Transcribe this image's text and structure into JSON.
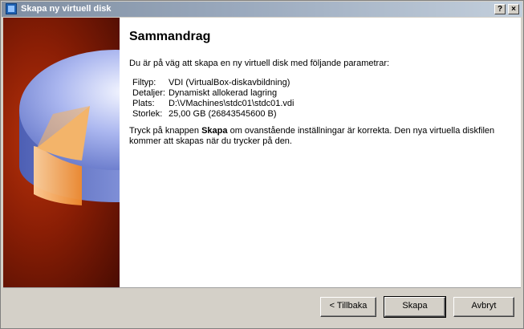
{
  "window": {
    "title": "Skapa ny virtuell disk",
    "help_glyph": "?",
    "close_glyph": "×",
    "icon": "virtualbox-icon"
  },
  "main": {
    "heading": "Sammandrag",
    "intro": "Du är på väg att skapa en ny virtuell disk med följande parametrar:",
    "params": [
      {
        "key": "Filtyp:",
        "value": "VDI (VirtualBox-diskavbildning)"
      },
      {
        "key": "Detaljer:",
        "value": "Dynamiskt allokerad lagring"
      },
      {
        "key": "Plats:",
        "value": "D:\\VMachines\\stdc01\\stdc01.vdi"
      },
      {
        "key": "Storlek:",
        "value": "25,00 GB (26843545600 B)"
      }
    ],
    "note_before": "Tryck på knappen ",
    "note_bold": "Skapa",
    "note_after": " om ovanstående inställningar är korrekta. Den nya virtuella diskfilen kommer att skapas när du trycker på den."
  },
  "buttons": {
    "back": "< Tillbaka",
    "create": "Skapa",
    "cancel": "Avbryt"
  },
  "colors": {
    "sidebar_bg": "#8a1e05",
    "disk_blue": "#7a8bd6",
    "disk_orange": "#f7a24a"
  }
}
